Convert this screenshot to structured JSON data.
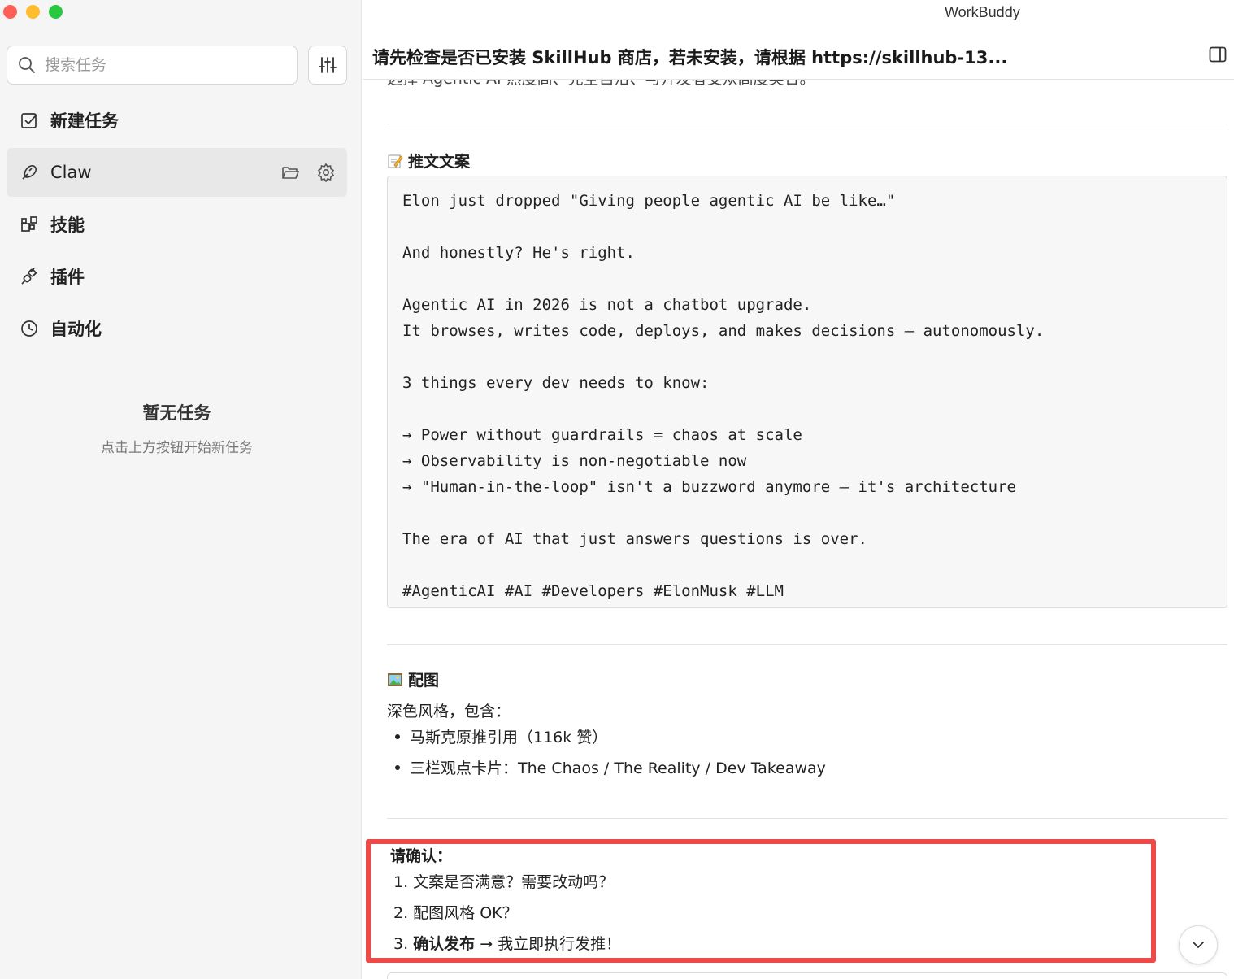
{
  "window": {
    "title": "WorkBuddy"
  },
  "sidebar": {
    "search_placeholder": "搜索任务",
    "items": [
      {
        "label": "新建任务",
        "icon": "new-task-icon"
      },
      {
        "label": "Claw",
        "icon": "claw-icon",
        "active": true
      },
      {
        "label": "技能",
        "icon": "skills-icon"
      },
      {
        "label": "插件",
        "icon": "plugin-icon"
      },
      {
        "label": "自动化",
        "icon": "clock-icon"
      }
    ],
    "empty": {
      "title": "暂无任务",
      "subtitle": "点击上方按钮开始新任务"
    }
  },
  "header": {
    "title": "请先检查是否已安装 SkillHub 商店，若未安装，请根据 https://skillhub-13..."
  },
  "content": {
    "cut_line": "选择 Agentic AI     热度高、完全自洽、与开发者受众高度契合。",
    "tweet": {
      "title": "推文文案",
      "lines": [
        "Elon just dropped \"Giving people agentic AI be like…\"",
        "",
        "And honestly? He's right.",
        "",
        "Agentic AI in 2026 is not a chatbot upgrade.",
        "It browses, writes code, deploys, and makes decisions — autonomously.",
        "",
        "3 things every dev needs to know:",
        "",
        "→ Power without guardrails = chaos at scale",
        "→ Observability is non-negotiable now",
        "→ \"Human-in-the-loop\" isn't a buzzword anymore — it's architecture",
        "",
        "The era of AI that just answers questions is over.",
        "",
        "#AgenticAI #AI #Developers #ElonMusk #LLM"
      ]
    },
    "image": {
      "title": "配图",
      "intro": "深色风格，包含：",
      "bullets": [
        "马斯克原推引用（116k 赞）",
        "三栏观点卡片：The Chaos / The Reality / Dev Takeaway"
      ]
    },
    "confirm": {
      "title": "请确认：",
      "item1": "1. 文案是否满意？需要改动吗？",
      "item2": "2. 配图风格 OK？",
      "item3_prefix": "3. ",
      "item3_bold": "确认发布",
      "item3_rest": " → 我立即执行发推！"
    }
  },
  "colors": {
    "highlight": "#ee4a4a",
    "sidebar_bg": "#f5f5f5"
  }
}
